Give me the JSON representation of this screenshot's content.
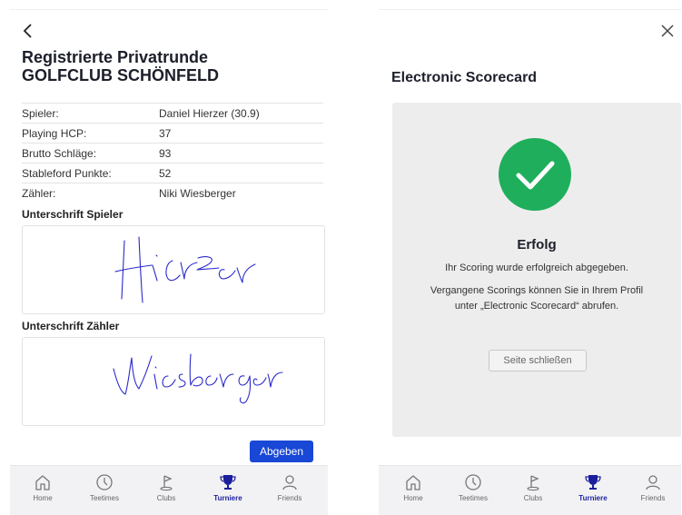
{
  "left": {
    "title_line1": "Registrierte Privatrunde",
    "title_line2": "GOLFCLUB SCHÖNFELD",
    "info": [
      {
        "label": "Spieler:",
        "value": "Daniel Hierzer (30.9)"
      },
      {
        "label": "Playing HCP:",
        "value": "37"
      },
      {
        "label": "Brutto Schläge:",
        "value": "93"
      },
      {
        "label": "Stableford Punkte:",
        "value": "52"
      },
      {
        "label": "Zähler:",
        "value": "Niki Wiesberger"
      }
    ],
    "sig_player_label": "Unterschrift Spieler",
    "sig_counter_label": "Unterschrift Zähler",
    "sig_player_text": "Hierzer",
    "sig_counter_text": "Wiesberger",
    "submit_label": "Abgeben"
  },
  "right": {
    "title": "Electronic Scorecard",
    "success_title": "Erfolg",
    "success_msg": "Ihr Scoring wurde erfolgreich abgegeben.",
    "info_line1": "Vergangene Scorings können Sie in Ihrem Profil",
    "info_line2": "unter „Electronic Scorecard“ abrufen.",
    "close_page_label": "Seite schließen"
  },
  "nav": {
    "home": "Home",
    "teetimes": "Teetimes",
    "clubs": "Clubs",
    "turniere": "Turniere",
    "friends": "Friends"
  },
  "colors": {
    "accent": "#1947d6",
    "success": "#1fae5c",
    "active_nav": "#1c1f9c",
    "ink": "#2a2acb"
  },
  "icons": {
    "back": "chevron-left-icon",
    "close": "close-icon",
    "success": "checkmark-circle-icon",
    "home": "home-icon",
    "teetimes": "clock-icon",
    "clubs": "golf-flag-icon",
    "turniere": "trophy-icon",
    "friends": "person-icon"
  }
}
